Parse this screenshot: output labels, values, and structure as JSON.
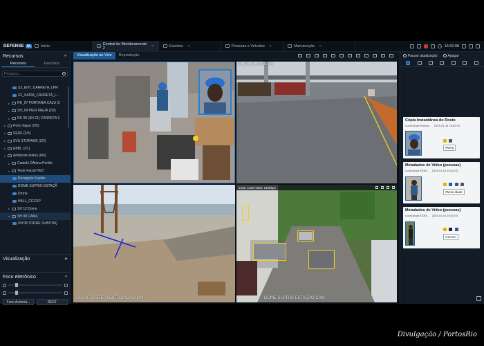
{
  "app": {
    "brand": "DEFENSE",
    "brand_badge": "IA"
  },
  "tabs": [
    {
      "label": "Início"
    },
    {
      "label": "Central de Monitoramento 2"
    },
    {
      "label": "Eventos"
    },
    {
      "label": "Pessoas e Veículos"
    },
    {
      "label": "Manutenção"
    }
  ],
  "status": {
    "time": "16:52:08"
  },
  "left": {
    "title": "Recursos",
    "subtabs": [
      "Recursos",
      "Favoritos"
    ],
    "search_placeholder": "Pesquisa...",
    "tree": [
      {
        "label": "S2_ENT_CARRETA_LPR"
      },
      {
        "label": "S2_SAIDA_CARRETA_L..."
      },
      {
        "label": "RK_07 PORTARIA CAJU (2"
      },
      {
        "label": "SH_04 PIER MAUÁ (2/2)"
      },
      {
        "label": "RK 08 (SH 21) CARRETA 2"
      },
      {
        "label": "Porto Itapuí (5/5)"
      },
      {
        "label": "SEDE (3/3)"
      },
      {
        "label": "SVS STORAGE (2/2)"
      },
      {
        "label": "EBBL (1/1)"
      },
      {
        "label": "Ambiente testes (6/6)"
      },
      {
        "label": "Castelo DAlana Portão"
      },
      {
        "label": "Teste Facial NVD"
      },
      {
        "label": "Recepção Suplão"
      },
      {
        "label": "DOME SUPRIO ESTAÇÃ"
      },
      {
        "label": "Drone"
      },
      {
        "label": "HALL_CCCSP"
      },
      {
        "label": "SH 12 Dome"
      },
      {
        "label": "SH 08 CAM4"
      },
      {
        "label": "SH 08 TORRE SUBSTAÇ"
      }
    ],
    "visualizacao": "Visualização",
    "foco": "Foco eletrônico",
    "btn_foco": "Foco Automá...",
    "btn_reset": "REST"
  },
  "center": {
    "tabs": [
      "Visualização ao Vivo",
      "Reprodução"
    ],
    "tile2_osd": "SZ_SH_01_CARRETA",
    "tile3_osd": "SH-08 TORRE SUBSTAÇÃO CAM 4",
    "tile4_bar": "1265, 1920*1080, 910kbps",
    "tile4_osd": "DOME SUPRIO ESTAÇÃO CAM"
  },
  "right": {
    "btn_pause": "Pausar atualização",
    "btn_clear": "Apagar",
    "cards": [
      {
        "title": "Cópia Instantânea do Rosto",
        "loc": "Local:Atual Recepç...",
        "date": "2024-01-16 16:52:03",
        "tag": "#Meia"
      },
      {
        "title": "Metadados de Vídeo (pessoas)",
        "loc": "Local:Atual IDOM...",
        "date": "2024-01-16 16:52:03",
        "tag": "#Mola Idade"
      },
      {
        "title": "Metadados de Vídeo (pessoas)",
        "loc": "Local:Atual IDOM...",
        "date": "2024-01-16 16:52:04",
        "tag": "#Jovem"
      }
    ]
  },
  "watermark": "Divulgação / PortosRio",
  "colors": {
    "accent": "#2d7fd0",
    "panel": "#121b26",
    "active_tab": "#1f5a93"
  }
}
